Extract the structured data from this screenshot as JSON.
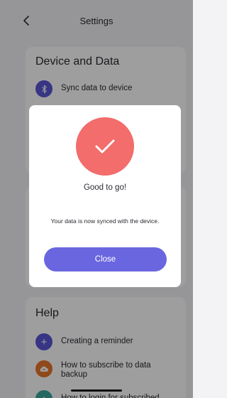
{
  "header": {
    "title": "Settings",
    "back_icon": "chevron-left-icon"
  },
  "device_section": {
    "title": "Device and Data",
    "items": [
      {
        "label": "Sync data to device",
        "icon": "bluetooth-icon"
      }
    ]
  },
  "help_section": {
    "title": "Help",
    "items": [
      {
        "label": "Creating a reminder",
        "icon": "plus-icon"
      },
      {
        "label": "How to subscribe to data backup",
        "icon": "cloud-upload-icon"
      },
      {
        "label": "How to login for subscribed",
        "icon": "login-icon"
      }
    ]
  },
  "modal": {
    "icon": "checkmark-icon",
    "title": "Good to go!",
    "message": "Your data is now synced with the device.",
    "close_label": "Close"
  },
  "colors": {
    "accent": "#6a66df",
    "success_circle": "#f26d6b",
    "icon_indigo": "#5a56d6",
    "icon_orange": "#e8762b",
    "icon_teal": "#3aa6a0"
  }
}
